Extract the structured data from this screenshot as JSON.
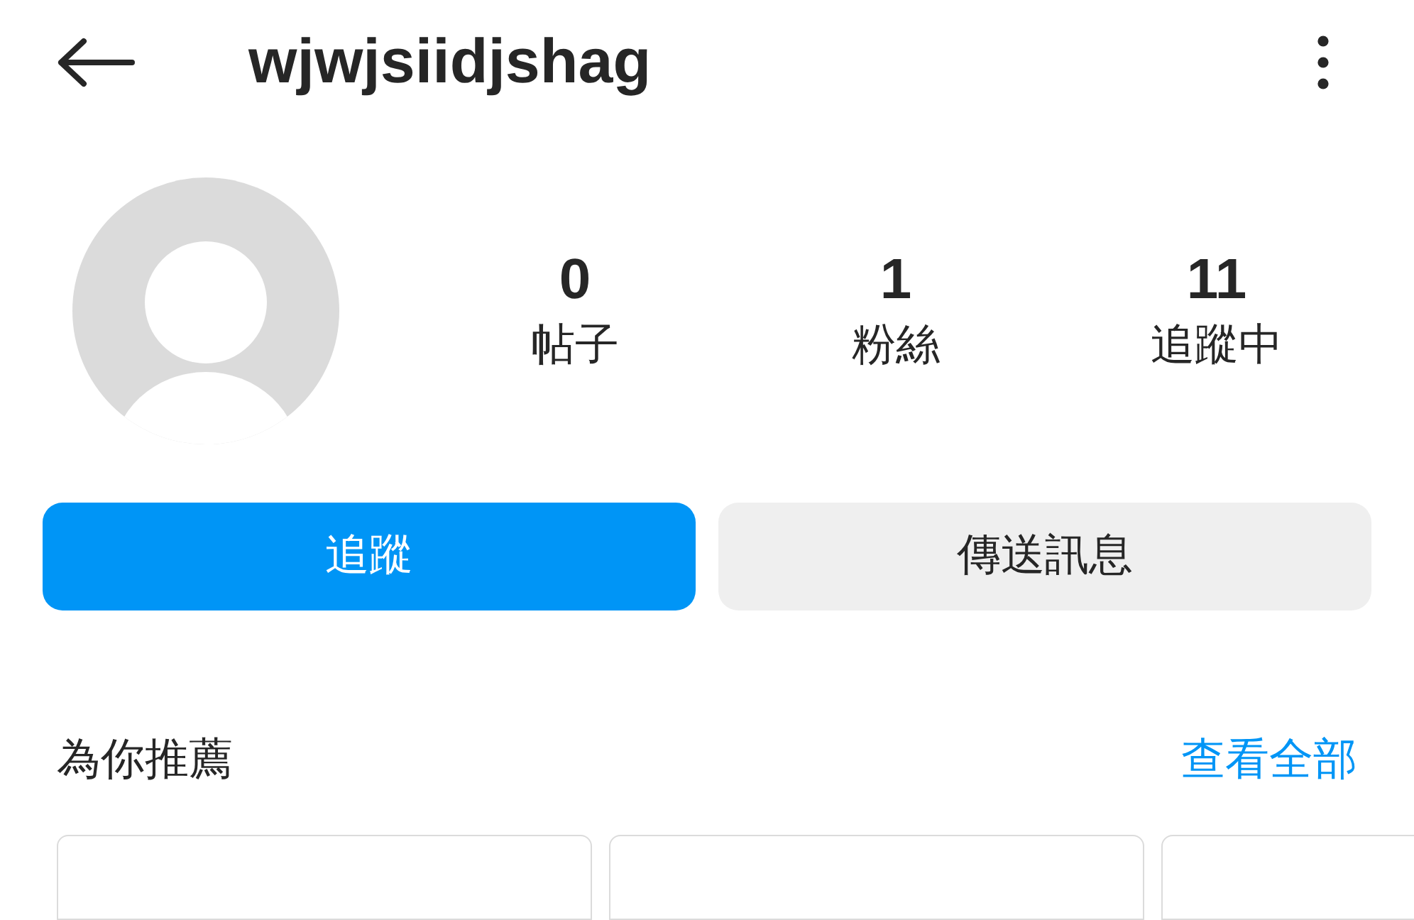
{
  "header": {
    "title": "wjwjsiidjshag"
  },
  "stats": [
    {
      "value": "0",
      "label": "帖子"
    },
    {
      "value": "1",
      "label": "粉絲"
    },
    {
      "value": "11",
      "label": "追蹤中"
    }
  ],
  "actions": [
    {
      "label": "追蹤",
      "kind": "primary"
    },
    {
      "label": "傳送訊息",
      "kind": "secondary"
    }
  ],
  "suggestions": {
    "title": "為你推薦",
    "link": "查看全部"
  }
}
